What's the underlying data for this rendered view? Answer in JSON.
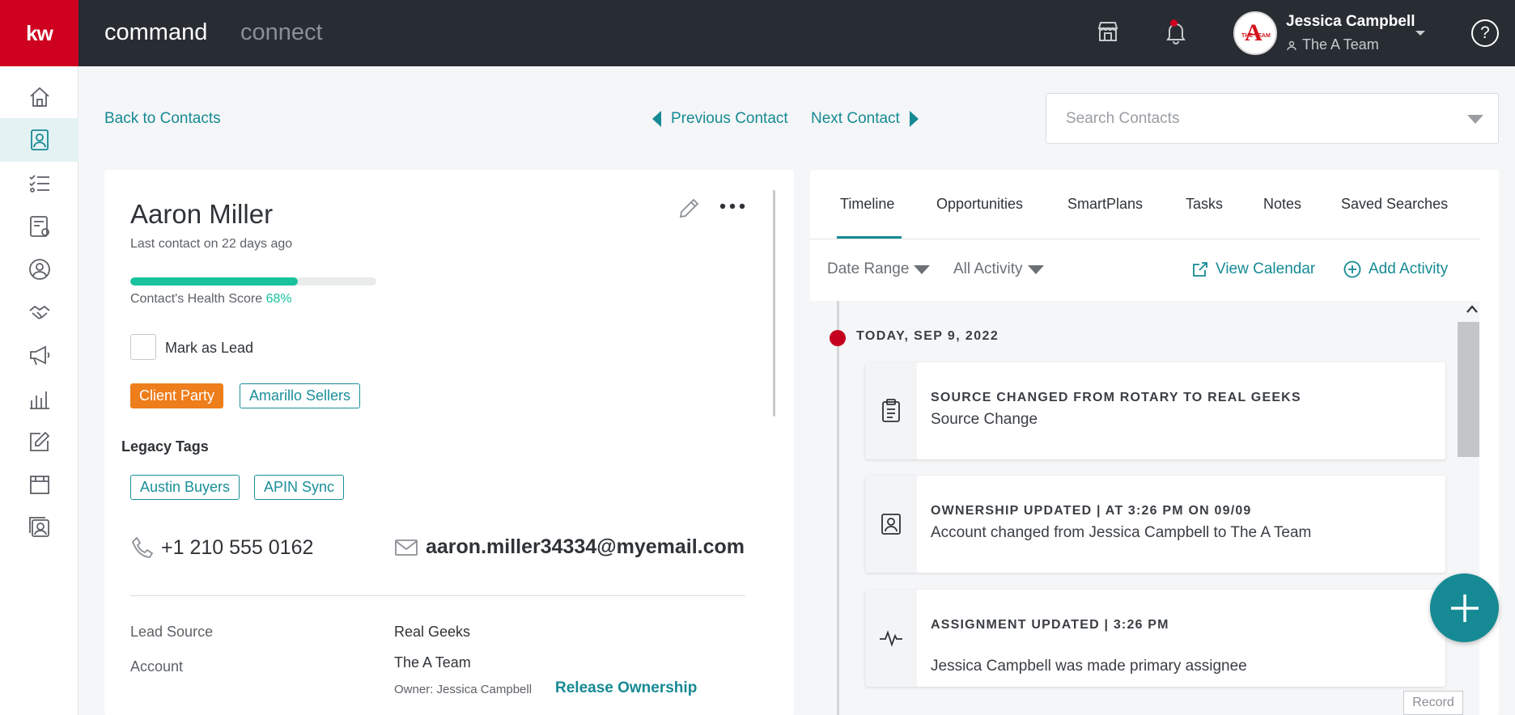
{
  "app": {
    "logo": "kw",
    "tabs": [
      "command",
      "connect"
    ]
  },
  "user": {
    "name": "Jessica Campbell",
    "team": "The A Team",
    "avatar_letter": "A",
    "avatar_text": "THE TEAM"
  },
  "sidebar": {
    "items": [
      {
        "icon": "home-icon",
        "active": false
      },
      {
        "icon": "contacts-icon",
        "active": true
      },
      {
        "icon": "tasks-list-icon",
        "active": false
      },
      {
        "icon": "settings-list-icon",
        "active": false
      },
      {
        "icon": "user-circle-icon",
        "active": false
      },
      {
        "icon": "handshake-icon",
        "active": false
      },
      {
        "icon": "megaphone-icon",
        "active": false
      },
      {
        "icon": "bar-chart-icon",
        "active": false
      },
      {
        "icon": "edit-icon",
        "active": false
      },
      {
        "icon": "calendar-board-icon",
        "active": false
      },
      {
        "icon": "photo-stack-icon",
        "active": false
      }
    ]
  },
  "nav": {
    "back": "Back to Contacts",
    "previous": "Previous Contact",
    "next": "Next Contact",
    "search_placeholder": "Search Contacts"
  },
  "contact": {
    "name": "Aaron Miller",
    "last_contact": "Last contact on 22 days ago",
    "health_label": "Contact's Health Score",
    "health_score": "68%",
    "health_value": 0.68,
    "mark_as_lead": "Mark as Lead",
    "tags": [
      "Client Party",
      "Amarillo Sellers"
    ],
    "legacy_tags_title": "Legacy Tags",
    "legacy_tags": [
      "Austin Buyers",
      "APIN Sync"
    ],
    "phone": "+1 210 555 0162",
    "email": "aaron.miller34334@myemail.com",
    "fields": {
      "lead_source_label": "Lead Source",
      "lead_source_value": "Real Geeks",
      "account_label": "Account",
      "account_value": "The A Team",
      "owner": "Owner: Jessica Campbell",
      "release": "Release Ownership"
    }
  },
  "tabs": [
    "Timeline",
    "Opportunities",
    "SmartPlans",
    "Tasks",
    "Notes",
    "Saved Searches"
  ],
  "filters": {
    "date_range": "Date Range",
    "all_activity": "All Activity",
    "view_calendar": "View Calendar",
    "add_activity": "Add Activity"
  },
  "timeline": {
    "date": "TODAY, SEP 9, 2022",
    "events": [
      {
        "icon": "clipboard-icon",
        "title": "SOURCE CHANGED FROM ROTARY TO REAL GEEKS",
        "desc": "Source Change"
      },
      {
        "icon": "contact-card-icon",
        "title": "OWNERSHIP UPDATED | AT 3:26 PM ON 09/09",
        "desc": "Account changed from Jessica Campbell to The A Team"
      },
      {
        "icon": "activity-pulse-icon",
        "title": "ASSIGNMENT UPDATED | 3:26 PM",
        "desc": "Jessica Campbell was made primary assignee"
      }
    ]
  },
  "record_label": "Record",
  "colors": {
    "accent": "#168a94",
    "brand_red": "#ce011f",
    "health_green": "#17c29c",
    "tag_orange": "#ee7d1b",
    "topbar": "#282c33"
  }
}
